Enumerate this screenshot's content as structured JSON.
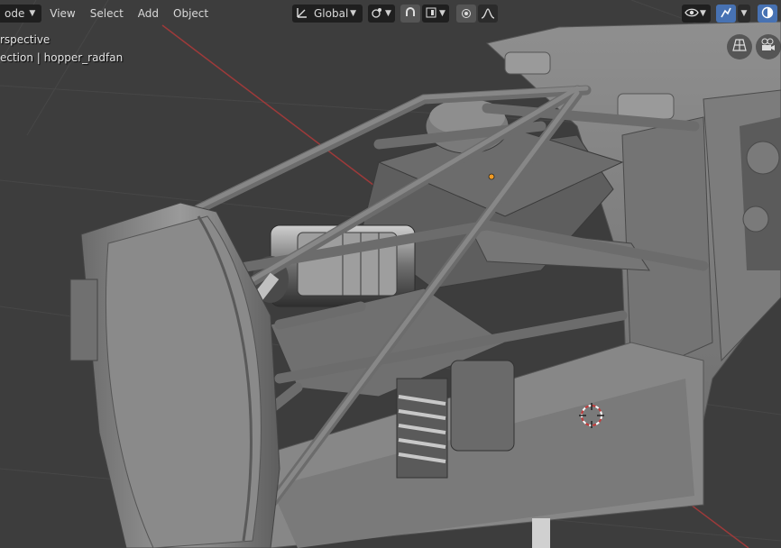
{
  "header": {
    "mode_label": "ode",
    "menus": [
      "View",
      "Select",
      "Add",
      "Object"
    ],
    "orientation_label": "Global"
  },
  "overlay": {
    "view_name": "rspective",
    "collection_info": "ection | hopper_radfan"
  },
  "colors": {
    "viewport_bg": "#3d3d3d",
    "header_button": "#2b2b2b",
    "active_blue": "#4772b3",
    "x_axis_red": "#9e3a3a"
  },
  "icons": [
    "object-mode-icon",
    "transform-orientation-icon",
    "pivot-icon",
    "snap-icon",
    "snap-increment-icon",
    "proportional-edit-icon",
    "falloff-icon",
    "visibility-icon",
    "gizmo-icon",
    "shading-icon",
    "grid-nav-icon",
    "camera-nav-icon"
  ]
}
